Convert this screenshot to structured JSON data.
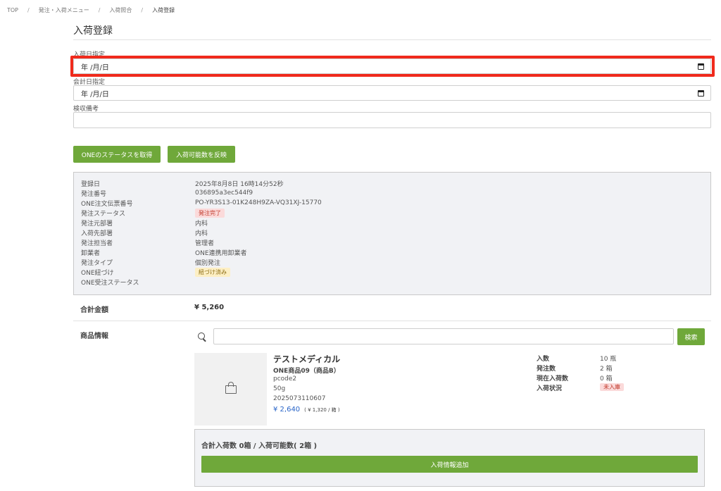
{
  "breadcrumb": [
    "TOP",
    "発注・入荷メニュー",
    "入荷照合",
    "入荷登録"
  ],
  "breadcrumb_separator": "/",
  "page_title": "入荷登録",
  "form": {
    "arrival_date_label": "入荷日指定",
    "arrival_date_value": "年 /月/日",
    "accounting_date_label": "会計日指定",
    "accounting_date_value": "年 /月/日",
    "inspection_note_label": "検収備考",
    "inspection_note_value": ""
  },
  "buttons": {
    "get_one_status": "ONEのステータスを取得",
    "reflect_available": "入荷可能数を反映",
    "search": "検索",
    "add_arrival_info": "入荷情報追加"
  },
  "order_info": [
    {
      "label": "登録日",
      "value": "2025年8月8日 16時14分52秒"
    },
    {
      "label": "発注番号",
      "value": "036895a3ec544f9"
    },
    {
      "label": "ONE注文伝票番号",
      "value": "PO-YR3S13-01K248H9ZA-VQ31XJ-15770"
    },
    {
      "label": "発注ステータス",
      "value": "発注完了"
    },
    {
      "label": "発注元部署",
      "value": "内科"
    },
    {
      "label": "入荷先部署",
      "value": "内科"
    },
    {
      "label": "発注担当者",
      "value": "管理者"
    },
    {
      "label": "卸業者",
      "value": "ONE連携用卸業者"
    },
    {
      "label": "発注タイプ",
      "value": "個別発注"
    },
    {
      "label": "ONE紐づけ",
      "value": "紐づけ済み"
    },
    {
      "label": "ONE受注ステータス",
      "value": ""
    }
  ],
  "total": {
    "label": "合計金額",
    "value": "¥ 5,260"
  },
  "product_section": {
    "label": "商品情報",
    "search_value": "",
    "product": {
      "name": "テストメディカル",
      "subtitle": "ONE商品09（商品B）",
      "code": "pcode2",
      "size": "50g",
      "jan": "2025073110607",
      "price": "¥ 2,640",
      "unit_price": "( ¥ 1,320 / 箱 )",
      "specs": [
        {
          "label": "入数",
          "value": "10 瓶"
        },
        {
          "label": "発注数",
          "value": "2 箱"
        },
        {
          "label": "現在入荷数",
          "value": "0 箱"
        },
        {
          "label": "入荷状況",
          "value": "未入庫"
        }
      ]
    },
    "summary": "合計入荷数 0箱 / 入荷可能数( 2箱 )"
  },
  "colors": {
    "accent_green": "#6fa83a",
    "highlight_red": "#f02a1c",
    "price_blue": "#2864c8"
  },
  "icons": [
    "calendar-icon",
    "search-icon",
    "shopping-bag-icon"
  ]
}
